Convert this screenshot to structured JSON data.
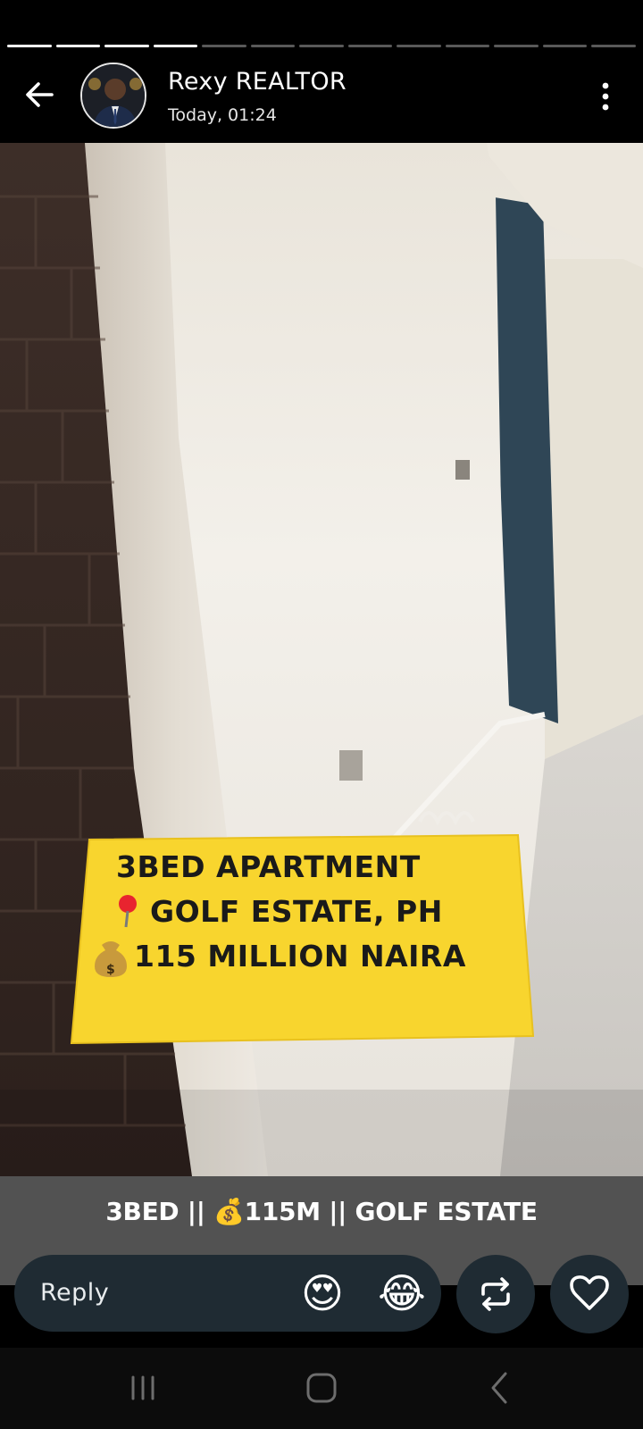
{
  "status": {
    "segments_total": 13,
    "segments_viewed": 4
  },
  "header": {
    "author": "Rexy REALTOR",
    "timestamp": "Today, 01:24",
    "back_icon": "arrow-left-icon",
    "menu_icon": "more-vertical-icon"
  },
  "media": {
    "overlay_lines": [
      "3BED APARTMENT",
      "GOLF ESTATE, PH",
      "115 MILLION NAIRA"
    ],
    "overlay_icons": [
      "round-pushpin-icon",
      "money-bag-icon"
    ],
    "overlay_color": "#f8d52e"
  },
  "caption": {
    "text": "3BED || 💰115M || GOLF ESTATE"
  },
  "reply": {
    "placeholder": "Reply",
    "emoji_1": "😍",
    "emoji_2": "😂",
    "repost_icon": "repost-icon",
    "like_icon": "heart-outline-icon"
  },
  "colors": {
    "panel": "#1f2b33",
    "caption_bar": "#696969"
  }
}
